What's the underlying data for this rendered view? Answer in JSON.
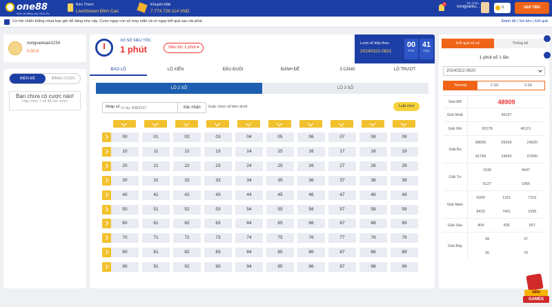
{
  "header": {
    "logo": "one88",
    "logo_sub": "Nhà cái đẳng cấp Châu Âu",
    "promo1_title": "Kèo Thơm",
    "promo1_sub": "LiveStream Đỉnh Cao",
    "promo2_title": "Khuyến Mãi",
    "promo2_sub": "7.774.728.114 VND",
    "notif_count": "8",
    "greeting": "Xin chào,",
    "username": "nongvantu...",
    "balance": "0",
    "deposit_label": "NẠP TIỀN"
  },
  "ticker": {
    "message": "Cơ hội chiến thắng chưa bao giờ dễ dàng như vậy. Cược ngay con số may mắn và có ngay kết quả sau vài phút.",
    "links": "Đánh đề | Soi kèo | Kết quả"
  },
  "user": {
    "name": "nongvantuan1234",
    "balance": "0.00 K"
  },
  "bet_panel": {
    "tab_active": "BIÊN ĐỀ",
    "tab_inactive": "BẢNG CƯỢC",
    "empty_title": "Bạn chưa có cược nào!",
    "empty_sub": "Hãy chọn 1 số để tạo cược"
  },
  "game": {
    "label": "XỔ SỐ SIÊU TỐC",
    "title": "1 phút",
    "speed_select": "Siêu tốc 1 phút ▾",
    "next_draw_label": "Lượt xổ tiếp theo",
    "next_draw_id": "20240322-0821",
    "minutes": "00",
    "minutes_unit": "Phút",
    "seconds": "41",
    "seconds_unit": "Giây",
    "categories": [
      "BAO LÔ",
      "LÔ XIÊN",
      "ĐẦU ĐUÔI",
      "ĐÁNH ĐỀ",
      "3 CÀNG",
      "LÔ TRƯỢT"
    ],
    "sub_tabs": [
      "LÔ 2 SỐ",
      "LÔ 3 SỐ"
    ],
    "input_label": "Nhập số",
    "input_placeholder": "Ví dụ: 8383237",
    "confirm_label": "Xác nhận",
    "or_text": "hoặc chọn số bên dưới",
    "rules_label": "Luật chơi",
    "numbers": [
      "00",
      "01",
      "02",
      "03",
      "04",
      "05",
      "06",
      "07",
      "08",
      "09",
      "10",
      "11",
      "12",
      "13",
      "14",
      "15",
      "16",
      "17",
      "18",
      "19",
      "20",
      "21",
      "22",
      "23",
      "24",
      "25",
      "26",
      "27",
      "28",
      "29",
      "30",
      "31",
      "32",
      "33",
      "34",
      "35",
      "36",
      "37",
      "38",
      "39",
      "40",
      "41",
      "42",
      "43",
      "44",
      "45",
      "46",
      "47",
      "48",
      "49",
      "50",
      "51",
      "52",
      "53",
      "54",
      "55",
      "56",
      "57",
      "58",
      "59",
      "60",
      "61",
      "62",
      "63",
      "64",
      "65",
      "66",
      "67",
      "68",
      "69",
      "70",
      "71",
      "72",
      "73",
      "74",
      "75",
      "76",
      "77",
      "78",
      "79",
      "80",
      "81",
      "82",
      "83",
      "84",
      "85",
      "86",
      "87",
      "88",
      "89",
      "90",
      "91",
      "92",
      "93",
      "94",
      "95",
      "96",
      "97",
      "98",
      "99"
    ]
  },
  "results": {
    "tab_active": "Kết quả xổ số",
    "tab_inactive": "Thống kê",
    "game_name": "1 phút xổ 1 lần",
    "date": "20240322-0820",
    "modes": [
      "Normal",
      "2 Số",
      "3 Số"
    ],
    "rows": [
      {
        "label": "Giải ĐB",
        "values": [
          "48909"
        ]
      },
      {
        "label": "Giải Nhất",
        "values": [
          "49107"
        ]
      },
      {
        "label": "Giải Nhì",
        "values": [
          "93178",
          "46121"
        ]
      },
      {
        "label": "Giải Ba",
        "values": [
          "88595",
          "09209",
          "24820",
          "91784",
          "24942",
          "97000"
        ]
      },
      {
        "label": "Giải Tư",
        "values": [
          "1530",
          "4647",
          "5127",
          "1955"
        ]
      },
      {
        "label": "Giải Năm",
        "values": [
          "6009",
          "1161",
          "7119",
          "8433",
          "7401",
          "1595"
        ]
      },
      {
        "label": "Giải Sáu",
        "values": [
          "404",
          "439",
          "657"
        ]
      },
      {
        "label": "Giải Bảy",
        "values": [
          "99",
          "37",
          "26",
          "76"
        ]
      }
    ]
  },
  "mini_games": {
    "line1": "MINI",
    "line2": "GAMES"
  },
  "colors": {
    "brand_blue": "#1d3fa5",
    "accent_orange": "#f06418",
    "accent_red": "#e33333",
    "yellow": "#f2c12e"
  }
}
